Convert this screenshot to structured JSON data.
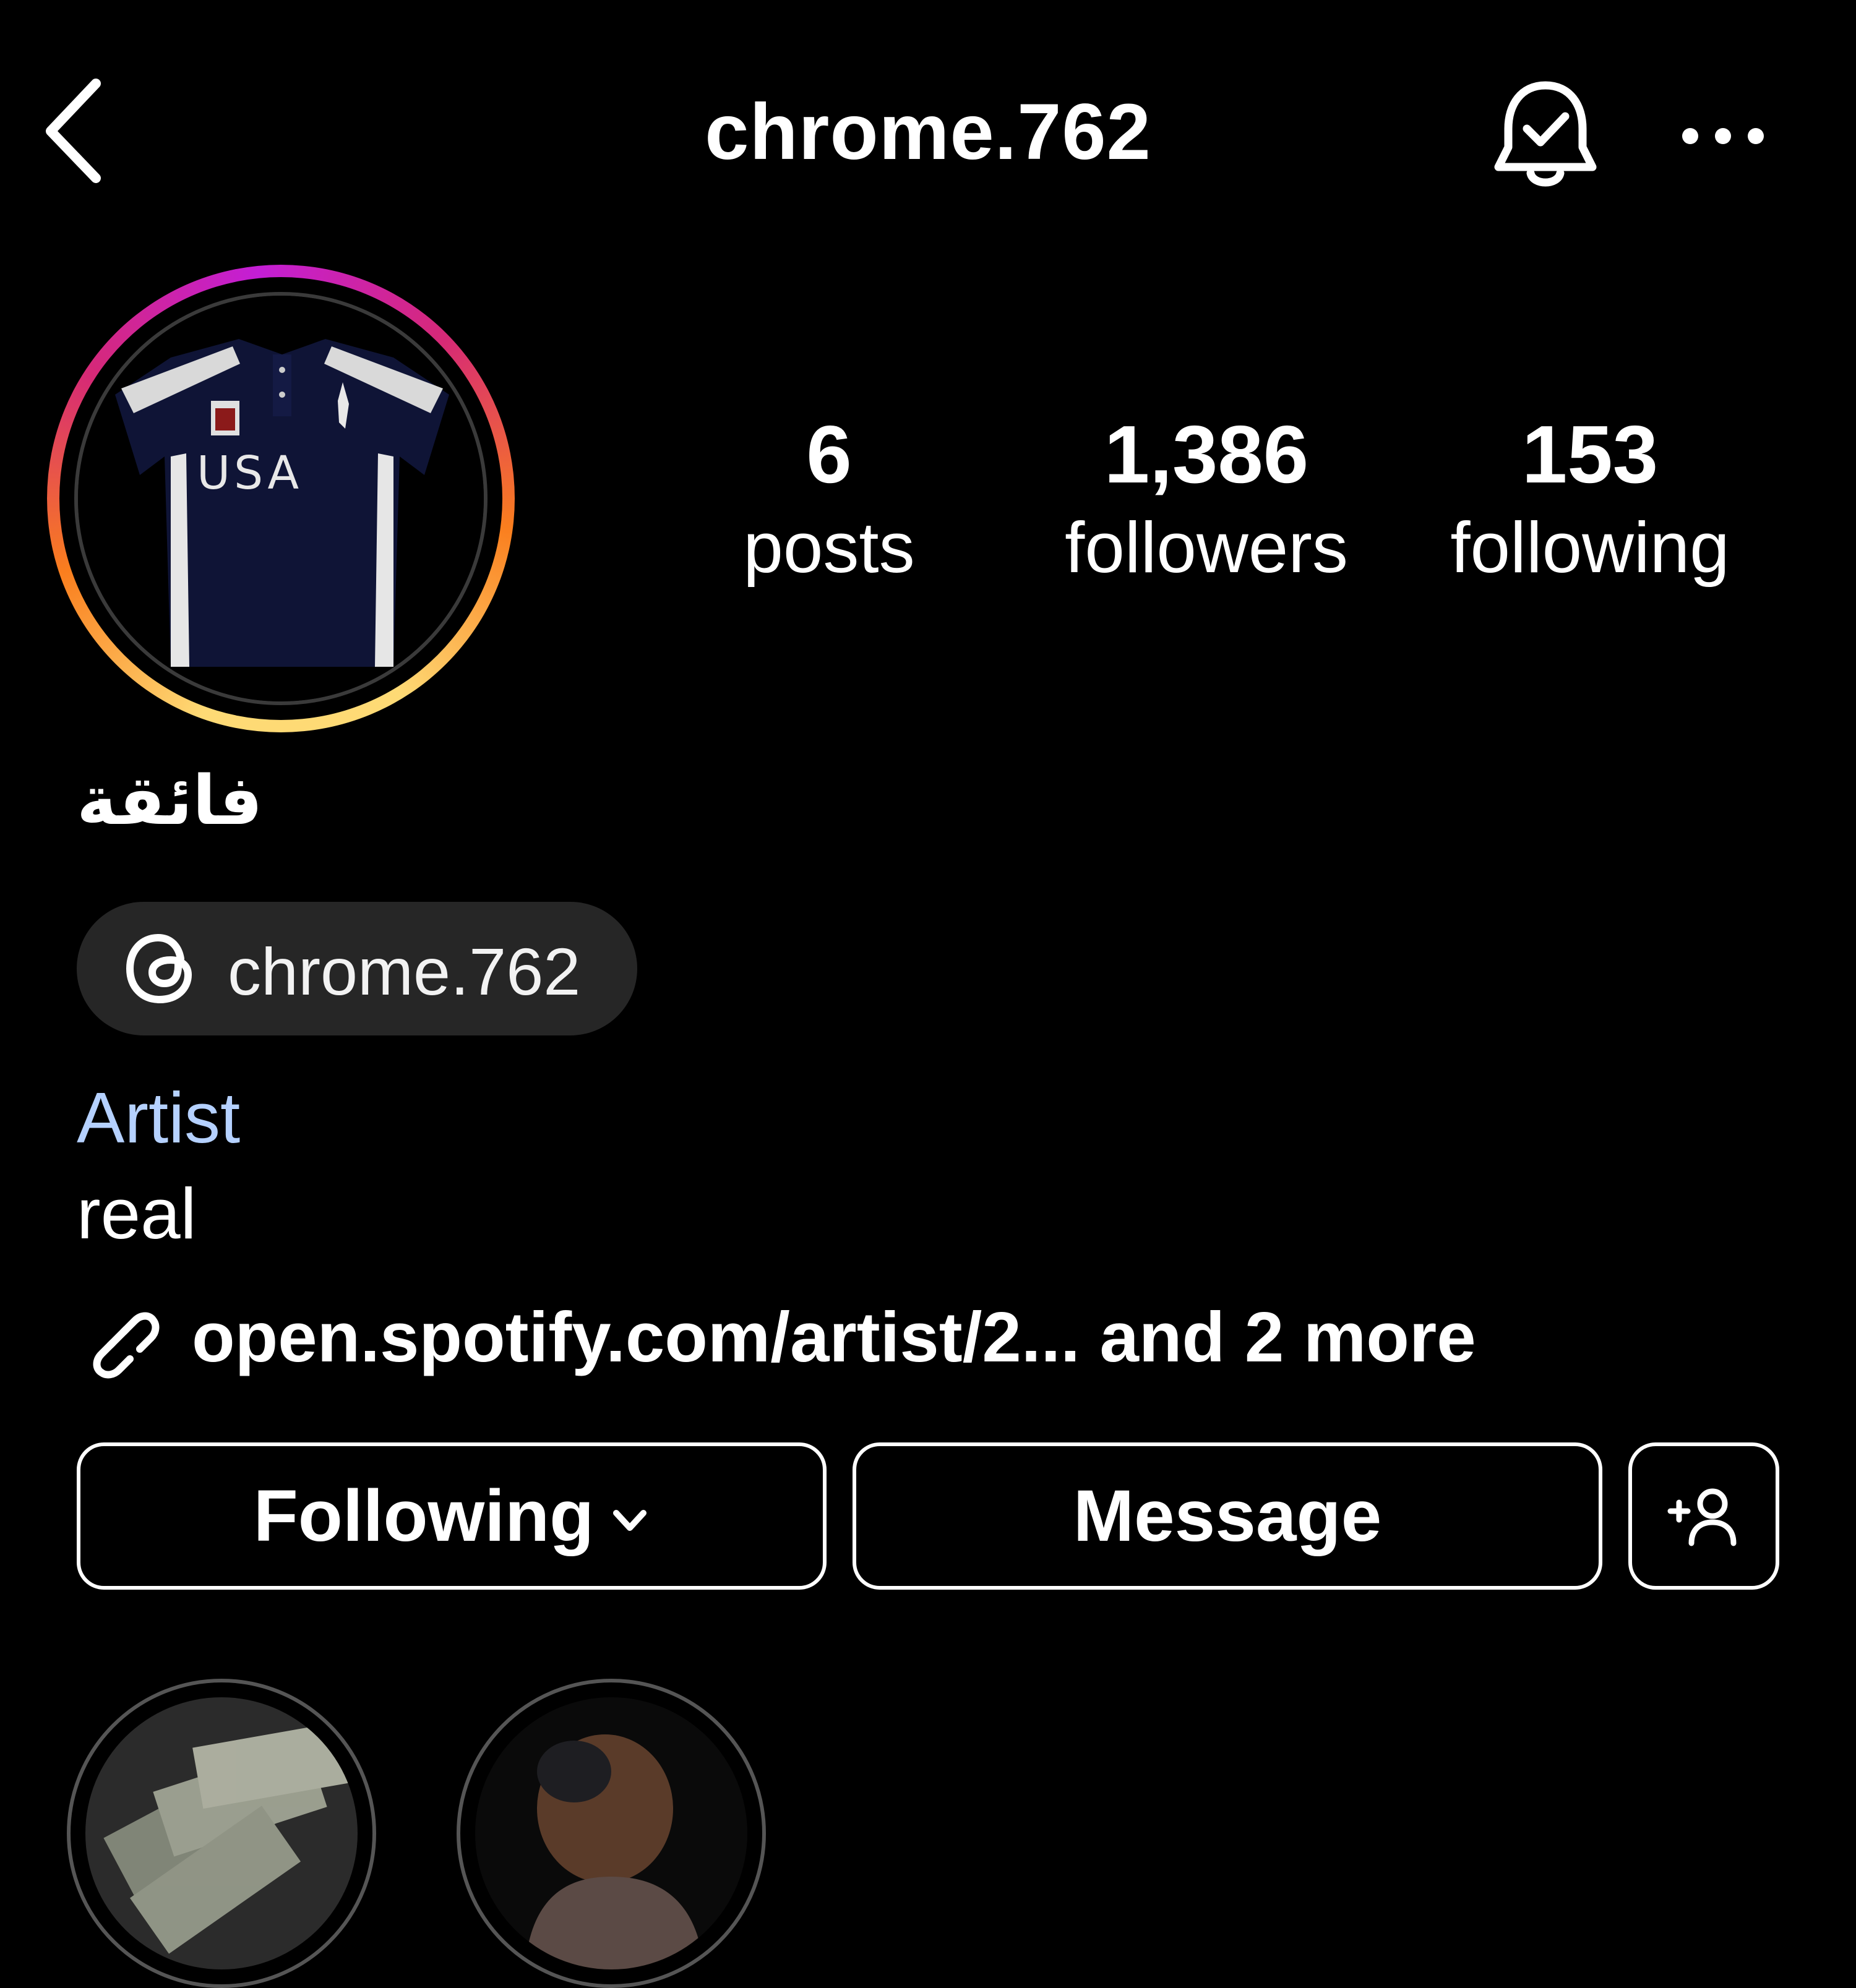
{
  "header": {
    "username": "chrome.762",
    "back_icon": "chevron-left-icon",
    "bell_icon": "bell-check-icon",
    "more_icon": "more-horizontal-icon"
  },
  "profile": {
    "avatar_alt": "USA",
    "display_name": "فائقة",
    "threads_handle": "chrome.762",
    "category": "Artist",
    "bio": "real",
    "link_text": "open.spotify.com/artist/2...  and 2 more"
  },
  "stats": {
    "posts": {
      "value": "6",
      "label": "posts"
    },
    "followers": {
      "value": "1,386",
      "label": "followers"
    },
    "following": {
      "value": "153",
      "label": "following"
    }
  },
  "actions": {
    "following_label": "Following",
    "message_label": "Message",
    "suggest_icon": "add-person-icon"
  },
  "colors": {
    "background": "#000000",
    "text": "#ffffff",
    "category": "#b5d1ff",
    "chip": "#262626"
  }
}
